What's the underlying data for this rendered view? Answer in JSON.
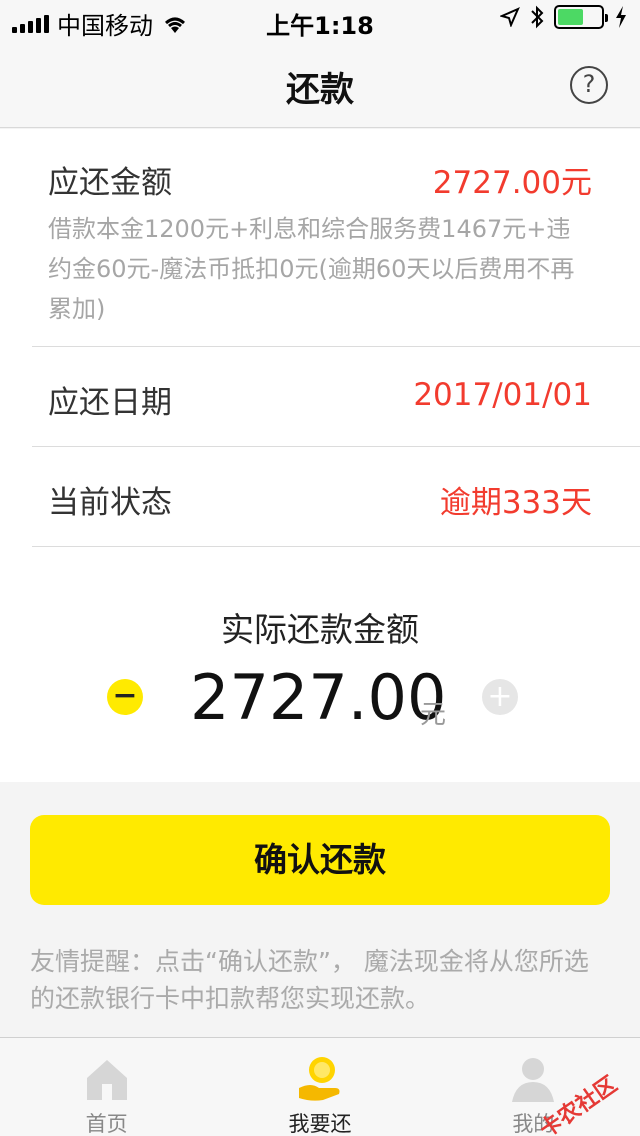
{
  "status_bar": {
    "carrier": "中国移动",
    "time": "上午1:18"
  },
  "nav": {
    "title": "还款",
    "help_icon": "question-circle-icon"
  },
  "amount_due": {
    "label": "应还金额",
    "value": "2727.00元",
    "description": "借款本金1200元+利息和综合服务费1467元+违约金60元-魔法币抵扣0元(逾期60天以后费用不再累加)"
  },
  "due_date": {
    "label": "应还日期",
    "value": "2017/01/01"
  },
  "status": {
    "label": "当前状态",
    "value": "逾期333天"
  },
  "actual_amount": {
    "title": "实际还款金额",
    "value": "2727.00",
    "unit": "元"
  },
  "confirm_button": "确认还款",
  "reminder": "友情提醒：点击“确认还款”， 魔法现金将从您所选的还款银行卡中扣款帮您实现还款。",
  "tabs": [
    {
      "label": "首页",
      "icon": "home-icon",
      "active": false
    },
    {
      "label": "我要还",
      "icon": "coin-hand-icon",
      "active": true
    },
    {
      "label": "我的",
      "icon": "user-icon",
      "active": false
    }
  ],
  "watermark": "卡农社区",
  "colors": {
    "accent": "#ffea00",
    "alert": "#f23b2e"
  }
}
